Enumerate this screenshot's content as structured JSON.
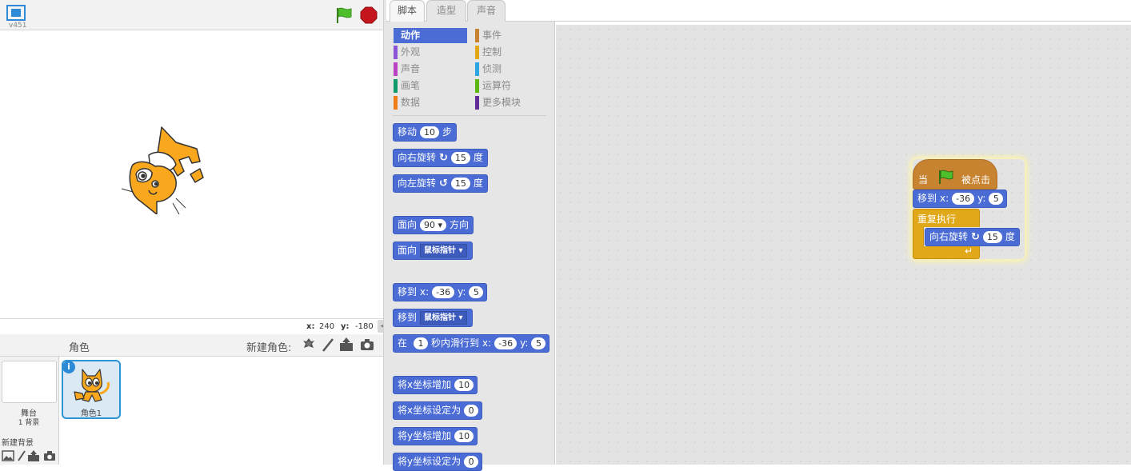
{
  "version": "v451",
  "stage": {
    "coords": {
      "x_label": "x:",
      "x_value": "240",
      "y_label": "y:",
      "y_value": "-180"
    }
  },
  "tabs": [
    {
      "label": "脚本",
      "active": true
    },
    {
      "label": "造型",
      "active": false
    },
    {
      "label": "声音",
      "active": false
    }
  ],
  "categories": [
    {
      "label": "动作",
      "color": "#4a6cd4",
      "active": true
    },
    {
      "label": "事件",
      "color": "#c88330",
      "active": false
    },
    {
      "label": "外观",
      "color": "#8a55d7",
      "active": false
    },
    {
      "label": "控制",
      "color": "#e1a91a",
      "active": false
    },
    {
      "label": "声音",
      "color": "#bb42c3",
      "active": false
    },
    {
      "label": "侦测",
      "color": "#2ca5e2",
      "active": false
    },
    {
      "label": "画笔",
      "color": "#0e9a6c",
      "active": false
    },
    {
      "label": "运算符",
      "color": "#5cb712",
      "active": false
    },
    {
      "label": "数据",
      "color": "#ee7d16",
      "active": false
    },
    {
      "label": "更多模块",
      "color": "#632d99",
      "active": false
    }
  ],
  "palette": {
    "move": {
      "label": "移动",
      "value": "10",
      "suffix": "步"
    },
    "turn_right": {
      "label": "向右旋转",
      "value": "15",
      "suffix": "度"
    },
    "turn_left": {
      "label": "向左旋转",
      "value": "15",
      "suffix": "度"
    },
    "point_dir": {
      "label": "面向",
      "value": "90",
      "suffix": "方向"
    },
    "point_towards": {
      "label": "面向",
      "option": "鼠标指针"
    },
    "goto_xy": {
      "label": "移到",
      "x_label": "x:",
      "x": "-36",
      "y_label": "y:",
      "y": "5"
    },
    "goto_obj": {
      "label": "移到",
      "option": "鼠标指针"
    },
    "glide": {
      "label": "在",
      "secs": "1",
      "mid": "秒内滑行到",
      "x_label": "x:",
      "x": "-36",
      "y_label": "y:",
      "y": "5"
    },
    "change_x": {
      "label": "将x坐标增加",
      "value": "10"
    },
    "set_x": {
      "label": "将x坐标设定为",
      "value": "0"
    },
    "change_y": {
      "label": "将y坐标增加",
      "value": "10"
    },
    "set_y": {
      "label": "将y坐标设定为",
      "value": "0"
    }
  },
  "script": {
    "hat_pre": "当",
    "hat_post": "被点击",
    "goto_label": "移到",
    "goto_x_label": "x:",
    "goto_x": "-36",
    "goto_y_label": "y:",
    "goto_y": "5",
    "forever_label": "重复执行",
    "turn_label": "向右旋转",
    "turn_value": "15",
    "turn_suffix": "度"
  },
  "sprites": {
    "header_label": "角色",
    "new_sprite_label": "新建角色:",
    "stage_label": "舞台",
    "stage_backdrops": "1 背景",
    "new_backdrop_label": "新建背景",
    "items": [
      {
        "name": "角色1"
      }
    ]
  }
}
